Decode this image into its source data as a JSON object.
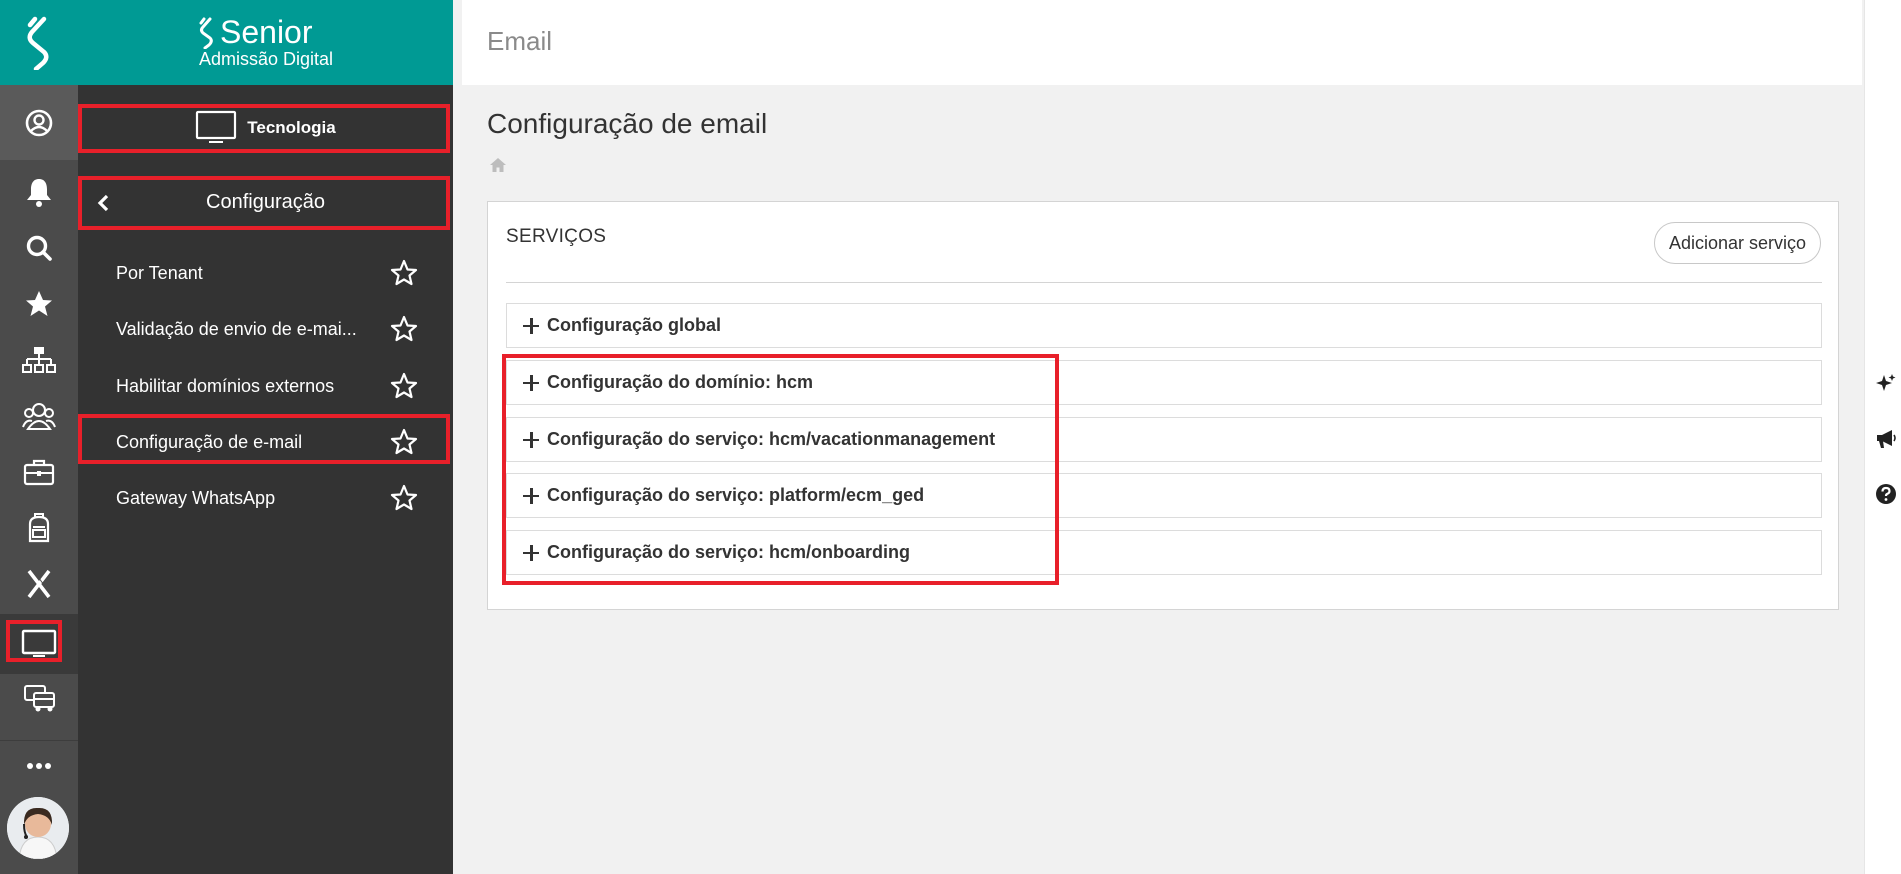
{
  "brand": {
    "name": "Senior",
    "subtitle": "Admissão Digital"
  },
  "menu": {
    "area_label": "Tecnologia",
    "section_label": "Configuração",
    "items": [
      {
        "label": "Por Tenant"
      },
      {
        "label": "Validação de envio de e-mai..."
      },
      {
        "label": "Habilitar domínios externos"
      },
      {
        "label": "Configuração de e-mail"
      },
      {
        "label": "Gateway WhatsApp"
      }
    ]
  },
  "header": {
    "title": "Email"
  },
  "main": {
    "page_title": "Configuração de email",
    "panel": {
      "title": "SERVIÇOS",
      "add_button": "Adicionar serviço",
      "sections": [
        {
          "label": "Configuração global"
        },
        {
          "label": "Configuração do domínio: hcm"
        },
        {
          "label": "Configuração do serviço: hcm/vacationmanagement"
        },
        {
          "label": "Configuração do serviço: platform/ecm_ged"
        },
        {
          "label": "Configuração do serviço: hcm/onboarding"
        }
      ]
    }
  },
  "colors": {
    "brand": "#009a94",
    "sidebar": "#333333",
    "rail": "#4b4b4b",
    "highlight": "#e8202a"
  },
  "icons": [
    "senior-logo-icon",
    "user-circle-icon",
    "bell-icon",
    "search-icon",
    "star-icon",
    "org-chart-icon",
    "people-group-icon",
    "briefcase-icon",
    "backpack-icon",
    "x-icon",
    "monitor-icon",
    "vehicles-icon",
    "more-icon",
    "home-icon",
    "sparkle-icon",
    "megaphone-icon",
    "help-icon"
  ]
}
